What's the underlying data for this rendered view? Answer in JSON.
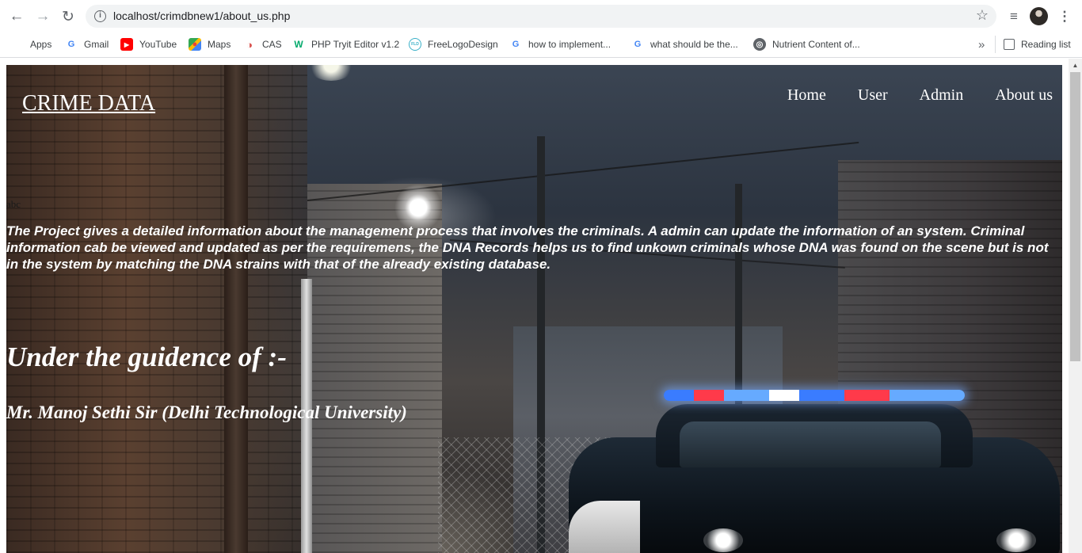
{
  "browser": {
    "url": "localhost/crimdbnew1/about_us.php",
    "bookmarks": [
      {
        "label": "Apps",
        "icon": "apps-grid-icon"
      },
      {
        "label": "Gmail",
        "icon": "google-icon"
      },
      {
        "label": "YouTube",
        "icon": "youtube-icon"
      },
      {
        "label": "Maps",
        "icon": "maps-icon"
      },
      {
        "label": "CAS",
        "icon": "cas-icon"
      },
      {
        "label": "PHP Tryit Editor v1.2",
        "icon": "w3schools-icon"
      },
      {
        "label": "FreeLogoDesign",
        "icon": "freelogodesign-icon"
      },
      {
        "label": "how to implement...",
        "icon": "google-icon"
      },
      {
        "label": "what should be the...",
        "icon": "google-icon"
      },
      {
        "label": "Nutrient Content of...",
        "icon": "globe-icon"
      }
    ],
    "more_bookmarks": "»",
    "reading_list": "Reading list"
  },
  "site": {
    "logo": "CRIME DATA",
    "nav": [
      "Home",
      "User",
      "Admin",
      "About us"
    ],
    "stray_text": "abc",
    "about_paragraph": "The Project gives a detailed information about the management process that involves the criminals. A admin can update the information of an system. Criminal information cab be viewed and updated as per the requiremens, the DNA Records helps us to find unkown criminals whose DNA was found on the scene but is not in the system by matching the DNA strains with that of the already existing database.",
    "guidance_heading": "Under the guidence of :-",
    "guide_name": "Mr. Manoj Sethi Sir (Delhi Technological University)"
  },
  "colors": {
    "text_on_image": "#ffffff",
    "chrome_icon": "#5f6368",
    "omnibox_bg": "#f1f3f4"
  }
}
